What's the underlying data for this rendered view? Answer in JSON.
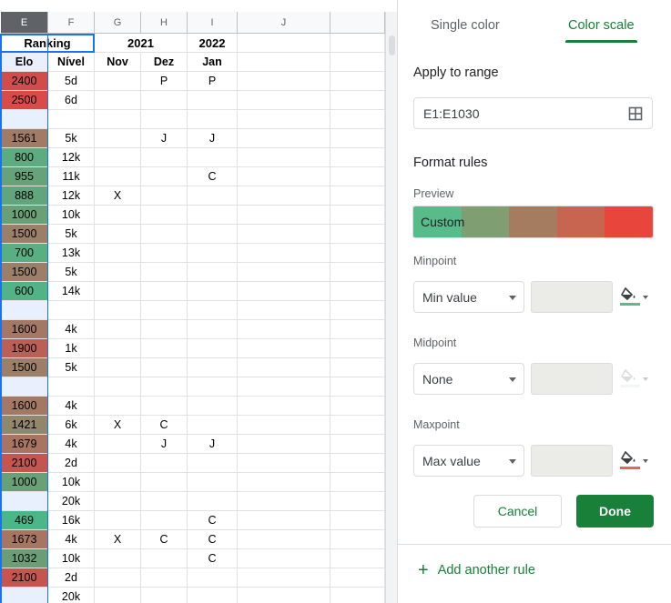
{
  "sheet": {
    "columns": [
      "E",
      "F",
      "G",
      "H",
      "I",
      "J"
    ],
    "active_column": "E",
    "header_row1": {
      "ranking": "Ranking",
      "year_2021": "2021",
      "year_2022": "2022"
    },
    "header_row2": {
      "elo": "Elo",
      "nivel": "Nível",
      "nov": "Nov",
      "dez": "Dez",
      "jan": "Jan"
    },
    "rows": [
      {
        "elo": "2400",
        "nivel": "5d",
        "g": "",
        "h": "P",
        "i": "P",
        "color": "#d24c4c"
      },
      {
        "elo": "2500",
        "nivel": "6d",
        "g": "",
        "h": "",
        "i": "",
        "color": "#d94a49"
      },
      {
        "elo": "",
        "nivel": "",
        "g": "",
        "h": "",
        "i": "",
        "color": "#e8f0fe"
      },
      {
        "elo": "1561",
        "nivel": "5k",
        "g": "",
        "h": "J",
        "i": "J",
        "color": "#a07c66"
      },
      {
        "elo": "800",
        "nivel": "12k",
        "g": "",
        "h": "",
        "i": "",
        "color": "#5dab80"
      },
      {
        "elo": "955",
        "nivel": "11k",
        "g": "",
        "h": "",
        "i": "C",
        "color": "#66a37a"
      },
      {
        "elo": "888",
        "nivel": "12k",
        "g": "X",
        "h": "",
        "i": "",
        "color": "#62a57c"
      },
      {
        "elo": "1000",
        "nivel": "10k",
        "g": "",
        "h": "",
        "i": "",
        "color": "#69a078"
      },
      {
        "elo": "1500",
        "nivel": "5k",
        "g": "",
        "h": "",
        "i": "",
        "color": "#9c7f68"
      },
      {
        "elo": "700",
        "nivel": "13k",
        "g": "",
        "h": "",
        "i": "",
        "color": "#58af82"
      },
      {
        "elo": "1500",
        "nivel": "5k",
        "g": "",
        "h": "",
        "i": "",
        "color": "#9c7f68"
      },
      {
        "elo": "600",
        "nivel": "14k",
        "g": "",
        "h": "",
        "i": "",
        "color": "#52b386"
      },
      {
        "elo": "",
        "nivel": "",
        "g": "",
        "h": "",
        "i": "",
        "color": "#e8f0fe"
      },
      {
        "elo": "1600",
        "nivel": "4k",
        "g": "",
        "h": "",
        "i": "",
        "color": "#a37965"
      },
      {
        "elo": "1900",
        "nivel": "1k",
        "g": "",
        "h": "",
        "i": "",
        "color": "#bb5f57"
      },
      {
        "elo": "1500",
        "nivel": "5k",
        "g": "",
        "h": "",
        "i": "",
        "color": "#9c7f68"
      },
      {
        "elo": "",
        "nivel": "",
        "g": "",
        "h": "",
        "i": "",
        "color": "#e8f0fe"
      },
      {
        "elo": "1600",
        "nivel": "4k",
        "g": "",
        "h": "",
        "i": "",
        "color": "#a37965"
      },
      {
        "elo": "1421",
        "nivel": "6k",
        "g": "X",
        "h": "C",
        "i": "",
        "color": "#92866c"
      },
      {
        "elo": "1679",
        "nivel": "4k",
        "g": "",
        "h": "J",
        "i": "J",
        "color": "#a87562"
      },
      {
        "elo": "2100",
        "nivel": "2d",
        "g": "",
        "h": "",
        "i": "",
        "color": "#c65550"
      },
      {
        "elo": "1000",
        "nivel": "10k",
        "g": "",
        "h": "",
        "i": "",
        "color": "#69a078"
      },
      {
        "elo": "",
        "nivel": "20k",
        "g": "",
        "h": "",
        "i": "",
        "color": "#e8f0fe"
      },
      {
        "elo": "469",
        "nivel": "16k",
        "g": "",
        "h": "",
        "i": "C",
        "color": "#4cb688"
      },
      {
        "elo": "1673",
        "nivel": "4k",
        "g": "X",
        "h": "C",
        "i": "C",
        "color": "#a87562"
      },
      {
        "elo": "1032",
        "nivel": "10k",
        "g": "",
        "h": "",
        "i": "C",
        "color": "#6b9e77"
      },
      {
        "elo": "2100",
        "nivel": "2d",
        "g": "",
        "h": "",
        "i": "",
        "color": "#c65550"
      },
      {
        "elo": "",
        "nivel": "20k",
        "g": "",
        "h": "",
        "i": "",
        "color": "#e8f0fe"
      }
    ]
  },
  "panel": {
    "tabs": {
      "single": "Single color",
      "scale": "Color scale"
    },
    "apply_range_label": "Apply to range",
    "range_value": "E1:E1030",
    "format_rules_label": "Format rules",
    "preview_label": "Preview",
    "preview_text": "Custom",
    "preview_colors": [
      "#57bb8a",
      "#7f9f73",
      "#a67c61",
      "#c86550",
      "#e8463d"
    ],
    "minpoint": {
      "label": "Minpoint",
      "value": "Min value",
      "color": "#57bb8a"
    },
    "midpoint": {
      "label": "Midpoint",
      "value": "None",
      "color": "#dbe8e0"
    },
    "maxpoint": {
      "label": "Maxpoint",
      "value": "Max value",
      "color": "#e06666"
    },
    "cancel": "Cancel",
    "done": "Done",
    "add_rule": "Add another rule"
  }
}
